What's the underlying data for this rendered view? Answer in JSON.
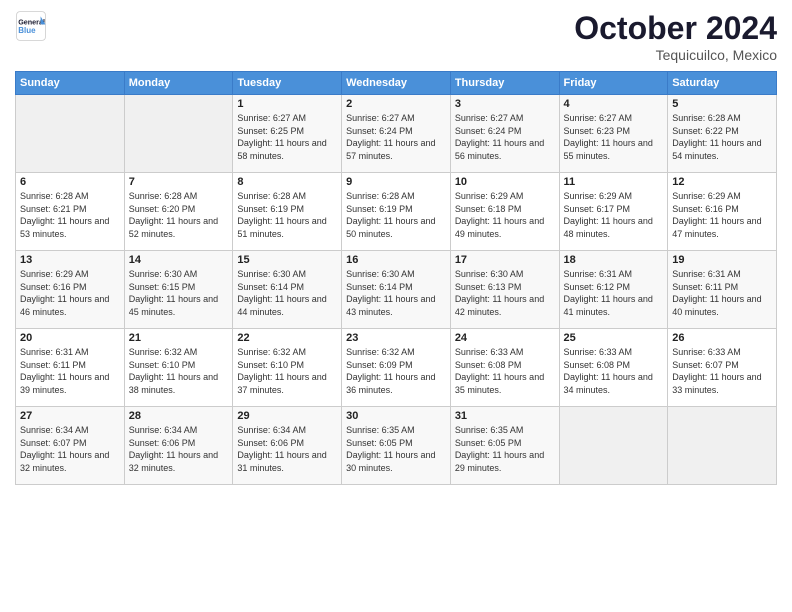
{
  "header": {
    "logo_line1": "General",
    "logo_line2": "Blue",
    "month": "October 2024",
    "location": "Tequicuilco, Mexico"
  },
  "weekdays": [
    "Sunday",
    "Monday",
    "Tuesday",
    "Wednesday",
    "Thursday",
    "Friday",
    "Saturday"
  ],
  "weeks": [
    [
      {
        "day": "",
        "info": ""
      },
      {
        "day": "",
        "info": ""
      },
      {
        "day": "1",
        "info": "Sunrise: 6:27 AM\nSunset: 6:25 PM\nDaylight: 11 hours and 58 minutes."
      },
      {
        "day": "2",
        "info": "Sunrise: 6:27 AM\nSunset: 6:24 PM\nDaylight: 11 hours and 57 minutes."
      },
      {
        "day": "3",
        "info": "Sunrise: 6:27 AM\nSunset: 6:24 PM\nDaylight: 11 hours and 56 minutes."
      },
      {
        "day": "4",
        "info": "Sunrise: 6:27 AM\nSunset: 6:23 PM\nDaylight: 11 hours and 55 minutes."
      },
      {
        "day": "5",
        "info": "Sunrise: 6:28 AM\nSunset: 6:22 PM\nDaylight: 11 hours and 54 minutes."
      }
    ],
    [
      {
        "day": "6",
        "info": "Sunrise: 6:28 AM\nSunset: 6:21 PM\nDaylight: 11 hours and 53 minutes."
      },
      {
        "day": "7",
        "info": "Sunrise: 6:28 AM\nSunset: 6:20 PM\nDaylight: 11 hours and 52 minutes."
      },
      {
        "day": "8",
        "info": "Sunrise: 6:28 AM\nSunset: 6:19 PM\nDaylight: 11 hours and 51 minutes."
      },
      {
        "day": "9",
        "info": "Sunrise: 6:28 AM\nSunset: 6:19 PM\nDaylight: 11 hours and 50 minutes."
      },
      {
        "day": "10",
        "info": "Sunrise: 6:29 AM\nSunset: 6:18 PM\nDaylight: 11 hours and 49 minutes."
      },
      {
        "day": "11",
        "info": "Sunrise: 6:29 AM\nSunset: 6:17 PM\nDaylight: 11 hours and 48 minutes."
      },
      {
        "day": "12",
        "info": "Sunrise: 6:29 AM\nSunset: 6:16 PM\nDaylight: 11 hours and 47 minutes."
      }
    ],
    [
      {
        "day": "13",
        "info": "Sunrise: 6:29 AM\nSunset: 6:16 PM\nDaylight: 11 hours and 46 minutes."
      },
      {
        "day": "14",
        "info": "Sunrise: 6:30 AM\nSunset: 6:15 PM\nDaylight: 11 hours and 45 minutes."
      },
      {
        "day": "15",
        "info": "Sunrise: 6:30 AM\nSunset: 6:14 PM\nDaylight: 11 hours and 44 minutes."
      },
      {
        "day": "16",
        "info": "Sunrise: 6:30 AM\nSunset: 6:14 PM\nDaylight: 11 hours and 43 minutes."
      },
      {
        "day": "17",
        "info": "Sunrise: 6:30 AM\nSunset: 6:13 PM\nDaylight: 11 hours and 42 minutes."
      },
      {
        "day": "18",
        "info": "Sunrise: 6:31 AM\nSunset: 6:12 PM\nDaylight: 11 hours and 41 minutes."
      },
      {
        "day": "19",
        "info": "Sunrise: 6:31 AM\nSunset: 6:11 PM\nDaylight: 11 hours and 40 minutes."
      }
    ],
    [
      {
        "day": "20",
        "info": "Sunrise: 6:31 AM\nSunset: 6:11 PM\nDaylight: 11 hours and 39 minutes."
      },
      {
        "day": "21",
        "info": "Sunrise: 6:32 AM\nSunset: 6:10 PM\nDaylight: 11 hours and 38 minutes."
      },
      {
        "day": "22",
        "info": "Sunrise: 6:32 AM\nSunset: 6:10 PM\nDaylight: 11 hours and 37 minutes."
      },
      {
        "day": "23",
        "info": "Sunrise: 6:32 AM\nSunset: 6:09 PM\nDaylight: 11 hours and 36 minutes."
      },
      {
        "day": "24",
        "info": "Sunrise: 6:33 AM\nSunset: 6:08 PM\nDaylight: 11 hours and 35 minutes."
      },
      {
        "day": "25",
        "info": "Sunrise: 6:33 AM\nSunset: 6:08 PM\nDaylight: 11 hours and 34 minutes."
      },
      {
        "day": "26",
        "info": "Sunrise: 6:33 AM\nSunset: 6:07 PM\nDaylight: 11 hours and 33 minutes."
      }
    ],
    [
      {
        "day": "27",
        "info": "Sunrise: 6:34 AM\nSunset: 6:07 PM\nDaylight: 11 hours and 32 minutes."
      },
      {
        "day": "28",
        "info": "Sunrise: 6:34 AM\nSunset: 6:06 PM\nDaylight: 11 hours and 32 minutes."
      },
      {
        "day": "29",
        "info": "Sunrise: 6:34 AM\nSunset: 6:06 PM\nDaylight: 11 hours and 31 minutes."
      },
      {
        "day": "30",
        "info": "Sunrise: 6:35 AM\nSunset: 6:05 PM\nDaylight: 11 hours and 30 minutes."
      },
      {
        "day": "31",
        "info": "Sunrise: 6:35 AM\nSunset: 6:05 PM\nDaylight: 11 hours and 29 minutes."
      },
      {
        "day": "",
        "info": ""
      },
      {
        "day": "",
        "info": ""
      }
    ]
  ]
}
